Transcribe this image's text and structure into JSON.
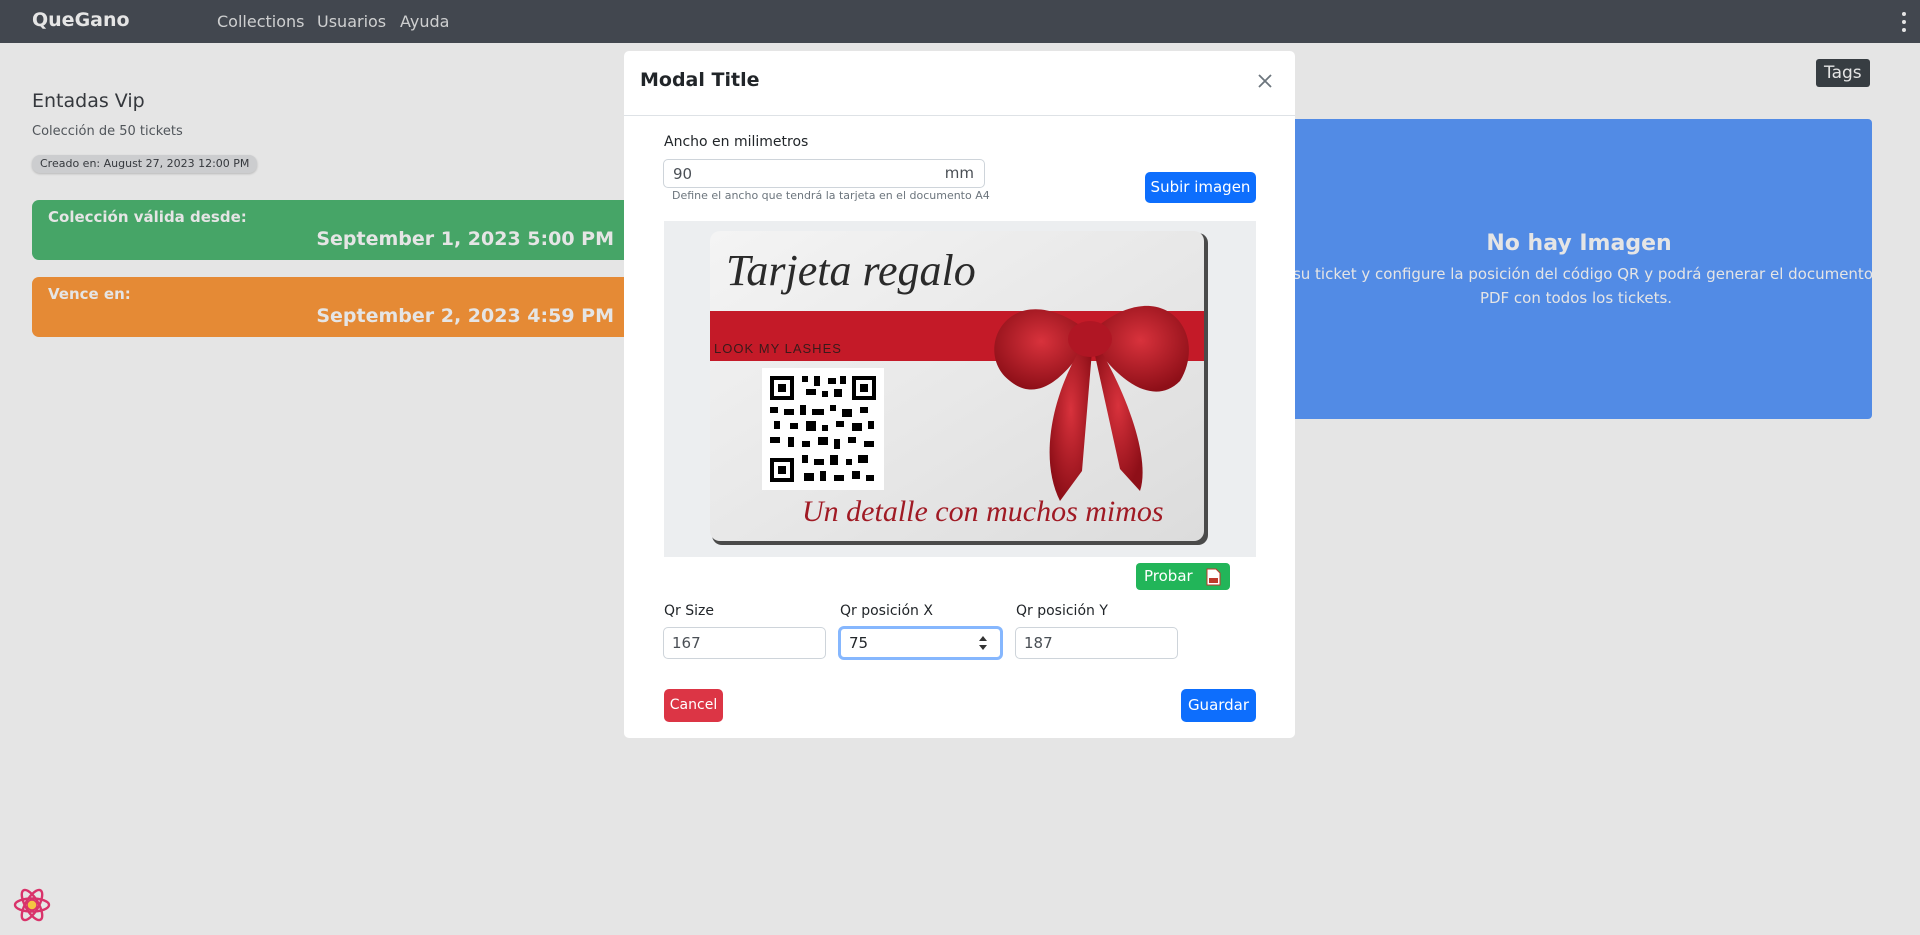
{
  "navbar": {
    "brand": "QueGano",
    "links": [
      "Collections",
      "Usuarios",
      "Ayuda"
    ]
  },
  "collection": {
    "title": "Entadas Vip",
    "subtitle": "Colección de 50 tickets",
    "created": "Creado en: August 27, 2023 12:00 PM",
    "valid_from_label": "Colección válida desde:",
    "valid_from_value": "September 1, 2023 5:00 PM",
    "expires_label": "Vence en:",
    "expires_value": "September 2, 2023 4:59 PM"
  },
  "tags_label": "Tags",
  "no_image": {
    "title": "No hay Imagen",
    "description_line1": "a su ticket y configure la posición del código QR y podrá generar el documento",
    "description_line2": "PDF con todos los tickets."
  },
  "modal": {
    "title": "Modal Title",
    "ancho_label": "Ancho en milimetros",
    "ancho_value": "90",
    "ancho_suffix": "mm",
    "ancho_help": "Define el ancho que tendrá la tarjeta en el documento A4",
    "subir_imagen": "Subir imagen",
    "ticket_image": {
      "heading": "Tarjeta regalo",
      "band_text": "LOOK MY LASHES",
      "footer_text": "Un detalle con muchos mimos"
    },
    "probar_label": "Probar",
    "qr_size_label": "Qr Size",
    "qr_size_value": "167",
    "qr_x_label": "Qr posición X",
    "qr_x_value": "75",
    "qr_y_label": "Qr posición Y",
    "qr_y_value": "187",
    "cancel_label": "Cancel",
    "guardar_label": "Guardar"
  },
  "icons": {
    "close": "close-icon",
    "menu": "kebab-menu-icon",
    "pdf": "pdf-file-icon",
    "react": "react-logo-icon"
  },
  "colors": {
    "navbar": "#4a5058",
    "valid_card": "#4fb873",
    "expires_card": "#ff9a3c",
    "no_image_panel": "#5c9bff",
    "primary_button": "#0d6efd",
    "probar_button": "#22b559",
    "cancel_button": "#dc3545"
  }
}
